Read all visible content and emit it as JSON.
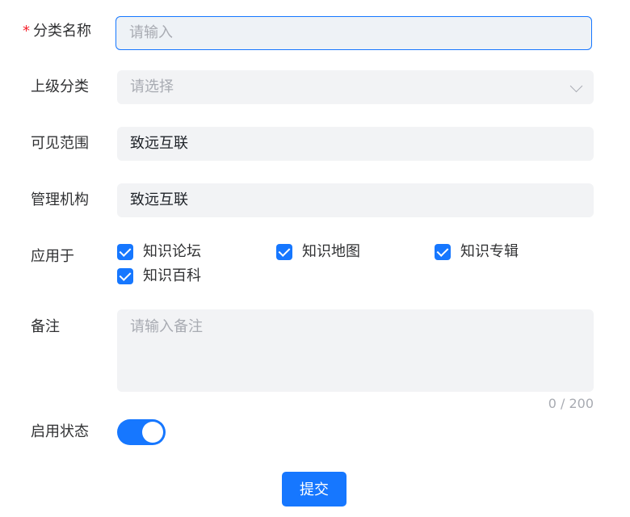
{
  "form": {
    "category_name": {
      "label": "分类名称",
      "required_mark": "*",
      "placeholder": "请输入"
    },
    "parent_category": {
      "label": "上级分类",
      "placeholder": "请选择"
    },
    "visibility": {
      "label": "可见范围",
      "value": "致远互联"
    },
    "management_org": {
      "label": "管理机构",
      "value": "致远互联"
    },
    "applied_to": {
      "label": "应用于",
      "options": [
        {
          "label": "知识论坛",
          "checked": true
        },
        {
          "label": "知识地图",
          "checked": true
        },
        {
          "label": "知识专辑",
          "checked": true
        },
        {
          "label": "知识百科",
          "checked": true
        }
      ]
    },
    "remarks": {
      "label": "备注",
      "placeholder": "请输入备注",
      "counter": "0 / 200"
    },
    "enabled": {
      "label": "启用状态",
      "on": true
    },
    "submit_label": "提交"
  },
  "colors": {
    "accent": "#1677ff",
    "required": "#f5222d",
    "field_bg": "#f2f3f5"
  },
  "icons": {
    "select_arrow": "chevron-down-icon",
    "checkbox": "check-icon"
  }
}
